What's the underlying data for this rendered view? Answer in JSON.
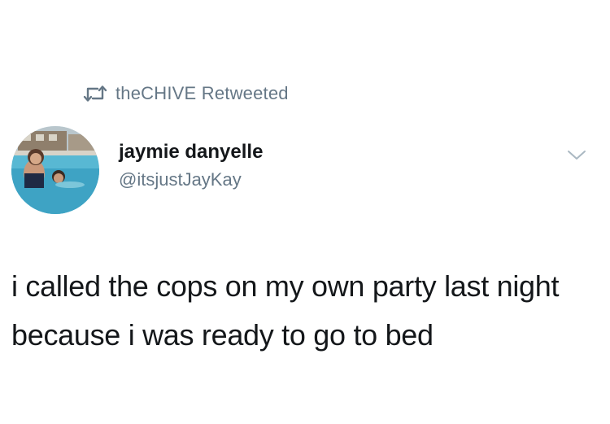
{
  "retweet": {
    "icon": "retweet-icon",
    "text": "theCHIVE Retweeted"
  },
  "author": {
    "avatar": "profile-photo-pool",
    "display_name": "jaymie danyelle",
    "handle": "@itsjustJayKay"
  },
  "menu": {
    "icon": "chevron-down-icon"
  },
  "tweet": {
    "text": "i called the cops on my own party last night because i was ready to go to bed"
  },
  "colors": {
    "text_primary": "#14171a",
    "text_secondary": "#657786",
    "background": "#ffffff"
  }
}
